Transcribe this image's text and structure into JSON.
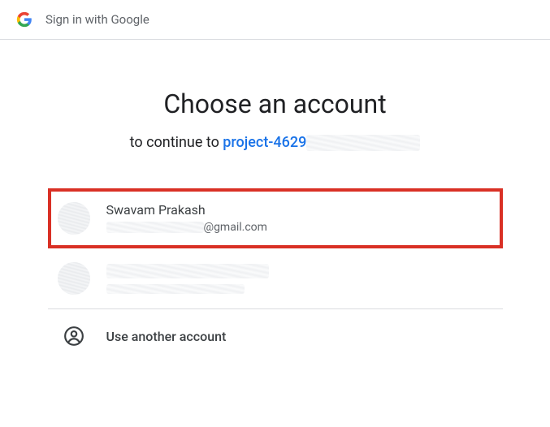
{
  "header": {
    "title": "Sign in with Google"
  },
  "main": {
    "title": "Choose an account",
    "subtitle_prefix": "to continue to ",
    "project_name": "project-4629"
  },
  "accounts": [
    {
      "name": "Swavam Prakash",
      "email_suffix": "@gmail.com",
      "highlighted": true
    },
    {
      "name": "",
      "email_suffix": "",
      "highlighted": false
    }
  ],
  "use_another": {
    "label": "Use another account"
  }
}
